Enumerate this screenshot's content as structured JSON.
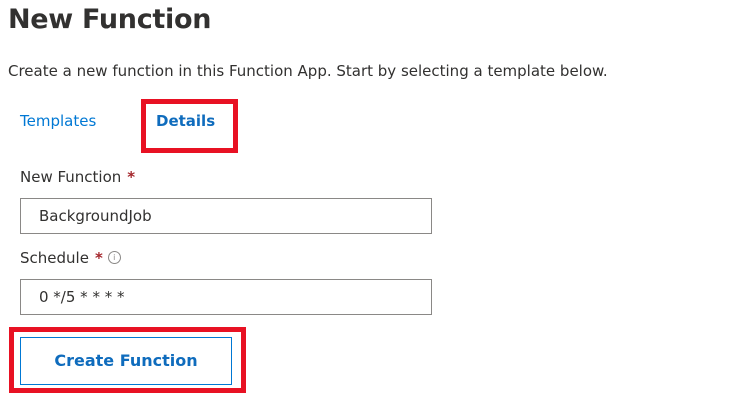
{
  "header": {
    "title": "New Function",
    "description": "Create a new function in this Function App. Start by selecting a template below."
  },
  "tabs": [
    {
      "label": "Templates",
      "active": false
    },
    {
      "label": "Details",
      "active": true
    }
  ],
  "form": {
    "function_name": {
      "label": "New Function",
      "required_marker": "*",
      "value": "BackgroundJob"
    },
    "schedule": {
      "label": "Schedule",
      "required_marker": "*",
      "info_icon": "ⓘ",
      "value": "0 */5 * * * *"
    }
  },
  "actions": {
    "create_label": "Create Function"
  },
  "colors": {
    "link": "#0078d4",
    "highlight": "#e81123",
    "required": "#a4262c",
    "text": "#323130"
  }
}
